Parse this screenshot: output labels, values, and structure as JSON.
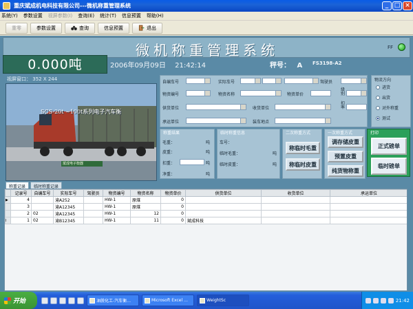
{
  "window": {
    "title": "重庆斌成机电科技有限公司---微机称重管理系统",
    "controls": [
      "_",
      "□",
      "×"
    ]
  },
  "menu": [
    {
      "label": "系统(Y)",
      "enabled": true
    },
    {
      "label": "参数设置",
      "enabled": true
    },
    {
      "label": "视屏参数(I)",
      "enabled": false
    },
    {
      "label": "查询(E)",
      "enabled": true
    },
    {
      "label": "统计(T)",
      "enabled": true
    },
    {
      "label": "信息预置",
      "enabled": true
    },
    {
      "label": "帮助(H)",
      "enabled": true
    }
  ],
  "toolbar": {
    "items": [
      {
        "label": "重零",
        "enabled": false,
        "icon": ""
      },
      {
        "label": "参数设置",
        "enabled": true,
        "icon": ""
      },
      {
        "label": "查询",
        "enabled": true,
        "icon": "binoculars-icon"
      },
      {
        "label": "信息预置",
        "enabled": true,
        "icon": ""
      },
      {
        "label": "退出",
        "enabled": true,
        "icon": "exit-door-icon"
      }
    ]
  },
  "banner": {
    "title": "微机称重管理系统",
    "ff": "FF",
    "status_color": "#11a011"
  },
  "weight": {
    "value": "0.000吨"
  },
  "datetime": {
    "date": "2006年09月09日",
    "time": "21:42:14"
  },
  "scale": {
    "label": "秤号：",
    "number": "A",
    "model": "FS3198-A2"
  },
  "video": {
    "label": "视屏窗口：",
    "size": "352 X 244",
    "overlay_text": "SCS-20t ~100t系列电子汽车衡",
    "bottom_text": "斌成电子衡器"
  },
  "form": {
    "labels": {
      "id_no": "自编车号",
      "plate": "实际车号",
      "weigher": "驾驶员",
      "goods_no": "物资编号",
      "goods_name": "物资名称",
      "goods_unit": "物资单价",
      "grade": "级别",
      "supplier": "供货单位",
      "receiver": "收货单位",
      "deduct": "扣率",
      "carrier": "承运单位",
      "location": "装车地点"
    }
  },
  "direction": {
    "title": "物流方向",
    "options": [
      {
        "label": "进货",
        "selected": false
      },
      {
        "label": "出货",
        "selected": false
      },
      {
        "label": "对外称重",
        "selected": false
      },
      {
        "label": "测试",
        "selected": true
      }
    ]
  },
  "weigh_result": {
    "title": "称重结果",
    "rows": [
      {
        "label": "毛重：",
        "unit": "吨"
      },
      {
        "label": "皮重：",
        "unit": "吨"
      },
      {
        "label": "扣重：",
        "unit": "吨"
      },
      {
        "label": "净重：",
        "unit": "吨"
      }
    ]
  },
  "temp_info": {
    "title": "临时称重信息",
    "rows": [
      {
        "label": "车号：",
        "unit": ""
      },
      {
        "label": "临时毛重：",
        "unit": "吨"
      },
      {
        "label": "临时皮重：",
        "unit": "吨"
      }
    ]
  },
  "second_weigh": {
    "title": "二次称重方式",
    "buttons": [
      "称临时毛重",
      "称临时皮重"
    ]
  },
  "first_weigh": {
    "title": "一次称重方式",
    "buttons": [
      "调存储皮重",
      "预置皮重",
      "纯货物称重"
    ]
  },
  "print": {
    "title": "打印",
    "buttons": [
      "正式磅单",
      "临时磅单"
    ]
  },
  "tabs": [
    {
      "label": "称重记录",
      "active": true
    },
    {
      "label": "临时称重记录",
      "active": false
    }
  ],
  "table": {
    "columns": [
      "记录号",
      "自编车号",
      "实际车号",
      "驾驶员",
      "物资编号",
      "物资名称",
      "物资单价",
      "供货单位",
      "收货单位",
      "承运单位"
    ],
    "rows": [
      {
        "marker": "▶",
        "cells": [
          "4",
          "",
          "渝A252",
          "",
          "HW-1",
          "原煤",
          "0",
          "",
          "",
          ""
        ]
      },
      {
        "marker": "",
        "cells": [
          "3",
          "",
          "渝A12345",
          "",
          "HW-1",
          "原煤",
          "0",
          "",
          "",
          ""
        ]
      },
      {
        "marker": "",
        "cells": [
          "2",
          "02",
          "渝A12345",
          "",
          "HW-1",
          "12",
          "0",
          "",
          "",
          ""
        ]
      },
      {
        "marker": "I",
        "cells": [
          "1",
          "02",
          "渝B12345",
          "",
          "HW-1",
          "11",
          "0",
          "斌成科技",
          "",
          ""
        ]
      }
    ]
  },
  "taskbar": {
    "start": "开始",
    "tasks": [
      {
        "label": "油脱化工-汽车衡…",
        "active": false
      },
      {
        "label": "Microsoft Excel …",
        "active": false
      },
      {
        "label": "WeightSc",
        "active": true
      }
    ],
    "clock": "21:42"
  }
}
